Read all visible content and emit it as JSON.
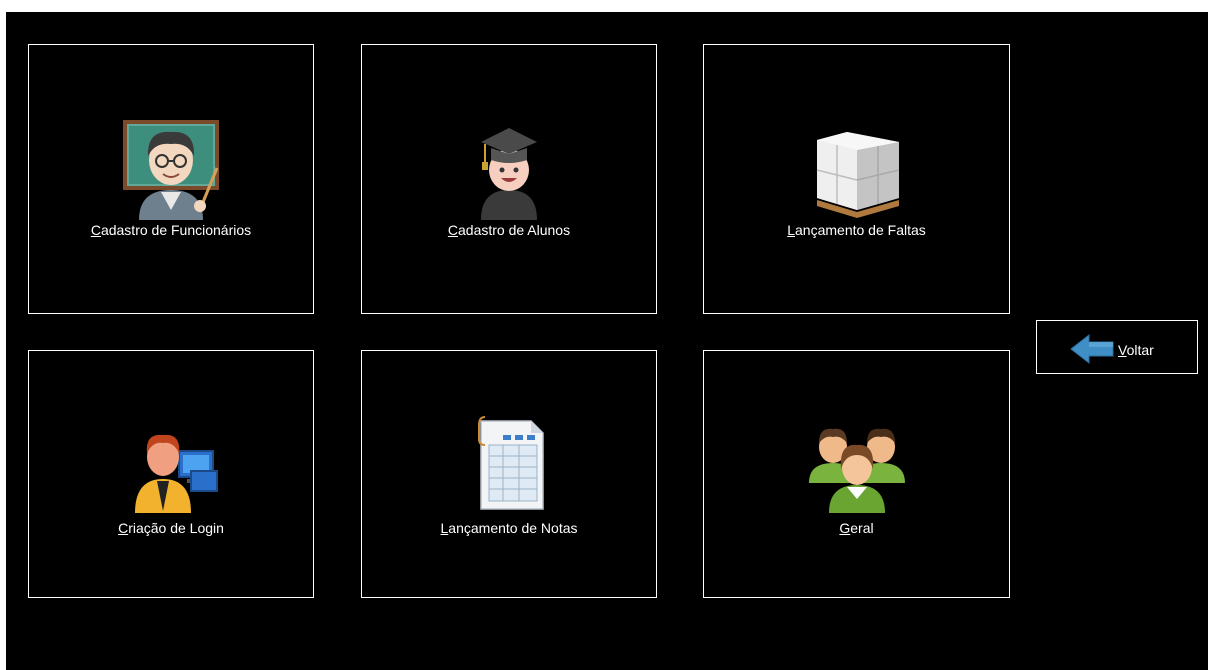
{
  "tiles": [
    {
      "label_hotkey": "C",
      "label_rest": "adastro de Funcionários",
      "icon": "teacher-icon"
    },
    {
      "label_hotkey": "C",
      "label_rest": "adastro de Alunos",
      "icon": "graduate-student-icon"
    },
    {
      "label_hotkey": "L",
      "label_rest": "ançamento de Faltas",
      "icon": "boxes-pallet-icon"
    },
    {
      "label_hotkey": "C",
      "label_rest": "riação de Login",
      "icon": "user-computer-icon"
    },
    {
      "label_hotkey": "L",
      "label_rest": "ançamento de Notas",
      "icon": "spreadsheet-document-icon"
    },
    {
      "label_hotkey": "G",
      "label_rest": "eral",
      "icon": "group-users-icon"
    }
  ],
  "back_button": {
    "label_hotkey": "V",
    "label_rest": "oltar",
    "icon": "back-arrow-icon"
  },
  "colors": {
    "background": "#000000",
    "border": "#ffffff",
    "text": "#ffffff",
    "arrow": "#3f8fc6"
  }
}
